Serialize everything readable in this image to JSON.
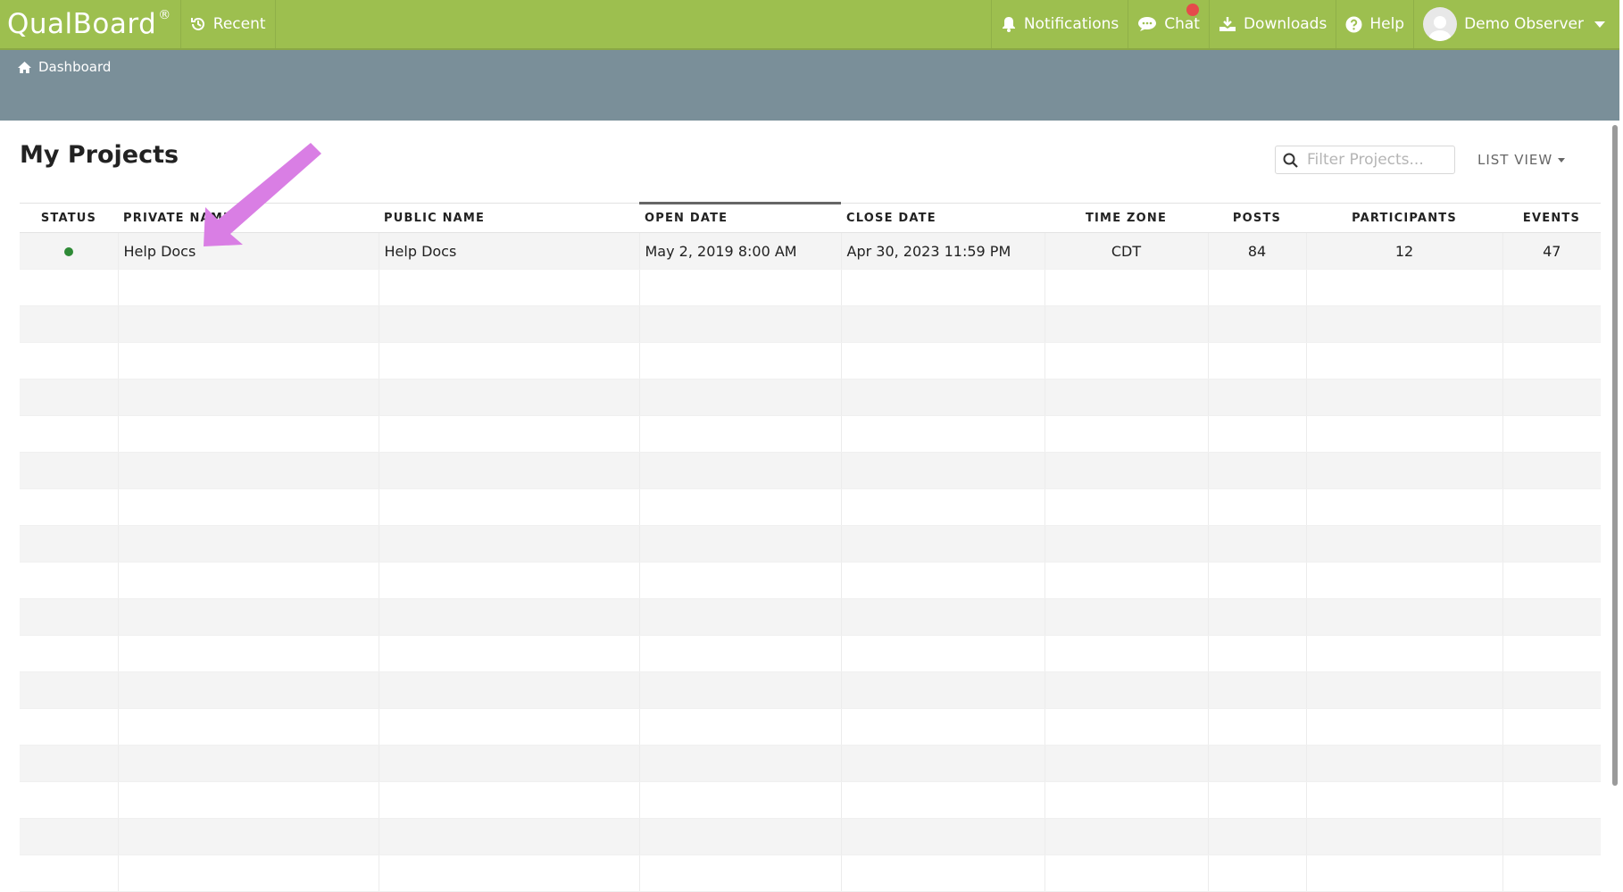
{
  "app": {
    "brand": "QualBoard",
    "brand_mark": "®"
  },
  "nav": {
    "recent": "Recent",
    "notifications": "Notifications",
    "chat": "Chat",
    "downloads": "Downloads",
    "help": "Help",
    "user": "Demo Observer"
  },
  "breadcrumb": {
    "dashboard": "Dashboard"
  },
  "page": {
    "title": "My Projects"
  },
  "filter": {
    "placeholder": "Filter Projects..."
  },
  "view": {
    "label": "LIST VIEW"
  },
  "table": {
    "headers": {
      "status": "STATUS",
      "private_name": "PRIVATE NAME",
      "public_name": "PUBLIC NAME",
      "open_date": "OPEN DATE",
      "close_date": "CLOSE DATE",
      "time_zone": "TIME ZONE",
      "posts": "POSTS",
      "participants": "PARTICIPANTS",
      "events": "EVENTS"
    },
    "rows": [
      {
        "status": "active",
        "private_name": "Help Docs",
        "public_name": "Help Docs",
        "open_date": "May 2, 2019 8:00 AM",
        "close_date": "Apr 30, 2023 11:59 PM",
        "time_zone": "CDT",
        "posts": "84",
        "participants": "12",
        "events": "47"
      }
    ]
  },
  "colors": {
    "topbar": "#9dbf4f",
    "subbar": "#7a8f99",
    "status_active": "#2e8a36",
    "annotation_arrow": "#d97ee4"
  }
}
